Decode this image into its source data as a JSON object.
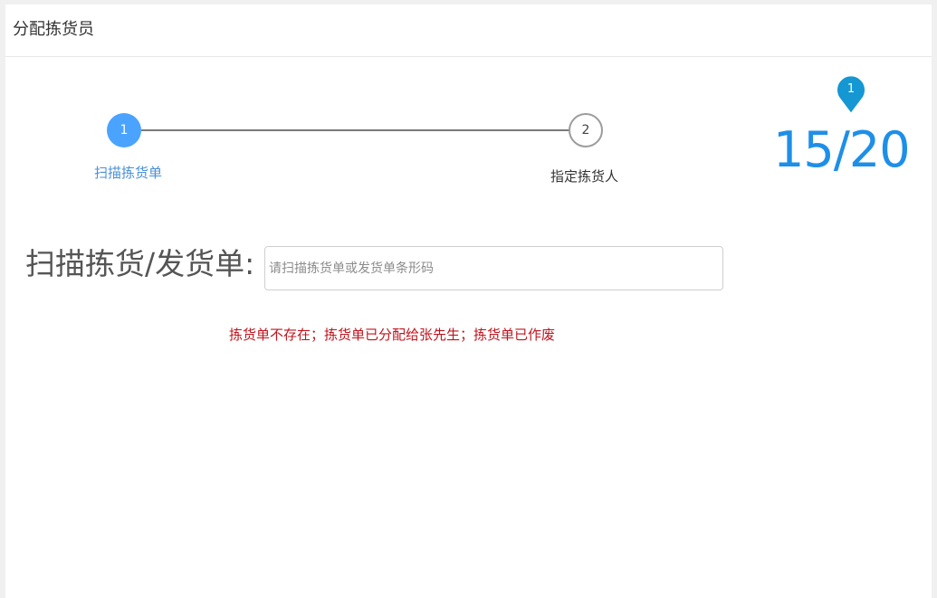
{
  "header": {
    "title": "分配拣货员"
  },
  "steps": [
    {
      "number": "1",
      "label": "扫描拣货单",
      "state": "active"
    },
    {
      "number": "2",
      "label": "指定拣货人",
      "state": "pending"
    }
  ],
  "counter": {
    "badge": "1",
    "value": "15/20"
  },
  "scan": {
    "label": "扫描拣货/发货单:",
    "placeholder": "请扫描拣货单或发货单条形码",
    "value": ""
  },
  "error": "拣货单不存在；拣货单已分配给张先生；拣货单已作废",
  "colors": {
    "accent": "#4aa3ff",
    "counter": "#1e8fe8",
    "error": "#c0141e",
    "badge": "#1497d3"
  }
}
